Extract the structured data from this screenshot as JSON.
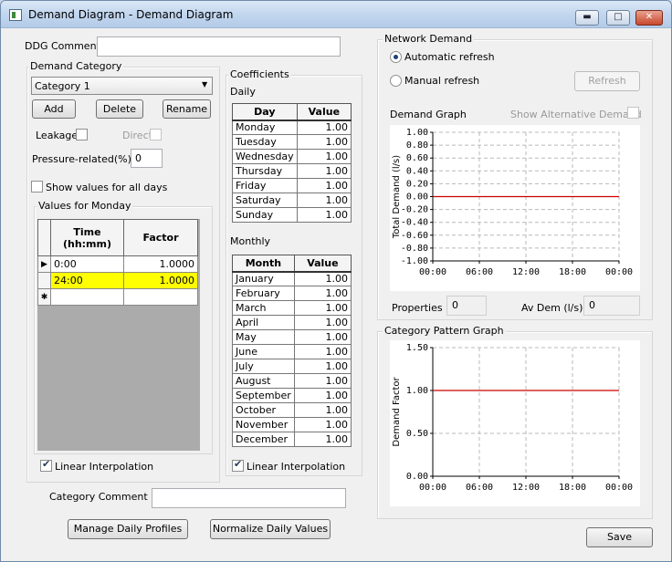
{
  "window": {
    "title": "Demand Diagram - Demand Diagram",
    "minimize": "▬",
    "maximize": "□",
    "close": "✕"
  },
  "ddg_comment": {
    "label": "DDG Comment",
    "value": ""
  },
  "demand_category": {
    "label": "Demand Category",
    "selected": "Category 1",
    "add": "Add",
    "delete": "Delete",
    "rename": "Rename",
    "leakage_label": "Leakage",
    "direct_label": "Direct",
    "pressure_label": "Pressure-related(%)",
    "pressure_value": "0",
    "show_all_days_label": "Show values for all days",
    "values_group_label": "Values for Monday",
    "table": {
      "headers": [
        "Time\n(hh:mm)",
        "Factor"
      ],
      "rows": [
        {
          "time": "0:00",
          "factor": "1.0000"
        },
        {
          "time": "24:00",
          "factor": "1.0000"
        }
      ],
      "new_row_marker": "✱",
      "current_row_marker": "▶"
    },
    "linear_interp_label": "Linear Interpolation"
  },
  "coefficients": {
    "label": "Coefficients",
    "daily_label": "Daily",
    "daily_headers": [
      "Day",
      "Value"
    ],
    "daily": [
      {
        "name": "Monday",
        "value": "1.00"
      },
      {
        "name": "Tuesday",
        "value": "1.00"
      },
      {
        "name": "Wednesday",
        "value": "1.00"
      },
      {
        "name": "Thursday",
        "value": "1.00"
      },
      {
        "name": "Friday",
        "value": "1.00"
      },
      {
        "name": "Saturday",
        "value": "1.00"
      },
      {
        "name": "Sunday",
        "value": "1.00"
      }
    ],
    "monthly_label": "Monthly",
    "monthly_headers": [
      "Month",
      "Value"
    ],
    "monthly": [
      {
        "name": "January",
        "value": "1.00"
      },
      {
        "name": "February",
        "value": "1.00"
      },
      {
        "name": "March",
        "value": "1.00"
      },
      {
        "name": "April",
        "value": "1.00"
      },
      {
        "name": "May",
        "value": "1.00"
      },
      {
        "name": "June",
        "value": "1.00"
      },
      {
        "name": "July",
        "value": "1.00"
      },
      {
        "name": "August",
        "value": "1.00"
      },
      {
        "name": "September",
        "value": "1.00"
      },
      {
        "name": "October",
        "value": "1.00"
      },
      {
        "name": "November",
        "value": "1.00"
      },
      {
        "name": "December",
        "value": "1.00"
      }
    ],
    "linear_interp_label": "Linear Interpolation"
  },
  "network_demand": {
    "label": "Network Demand",
    "auto_refresh": "Automatic refresh",
    "manual_refresh": "Manual refresh",
    "refresh_button": "Refresh",
    "graph_label": "Demand Graph",
    "show_alt_label": "Show Alternative Demand",
    "properties_label": "Properties",
    "properties_value": "0",
    "avdem_label": "Av Dem (l/s)",
    "avdem_value": "0"
  },
  "category_comment": {
    "label": "Category Comment",
    "value": ""
  },
  "buttons": {
    "manage": "Manage Daily Profiles",
    "normalize": "Normalize Daily Values",
    "save": "Save"
  },
  "pattern_group_label": "Category Pattern Graph",
  "colors": {
    "series": "#cc0000",
    "highlight": "#ffff00"
  },
  "chart_data": [
    {
      "type": "line",
      "ylabel": "Total Demand (l/s)",
      "xlabel": "",
      "x_ticks": [
        "00:00",
        "06:00",
        "12:00",
        "18:00",
        "00:00"
      ],
      "y_ticks": [
        "1.00",
        "0.80",
        "0.60",
        "0.40",
        "0.20",
        "0.00",
        "-0.20",
        "-0.40",
        "-0.60",
        "-0.80",
        "-1.00"
      ],
      "ylim": [
        -1.0,
        1.0
      ],
      "xlim": [
        0,
        24
      ],
      "grid": true,
      "series": [
        {
          "x": [
            0,
            24
          ],
          "y": [
            0.0,
            0.0
          ]
        }
      ]
    },
    {
      "type": "line",
      "ylabel": "Demand Factor",
      "xlabel": "",
      "x_ticks": [
        "00:00",
        "06:00",
        "12:00",
        "18:00",
        "00:00"
      ],
      "y_ticks": [
        "1.50",
        "1.00",
        "0.50",
        "0.00"
      ],
      "ylim": [
        0.0,
        1.5
      ],
      "xlim": [
        0,
        24
      ],
      "grid": true,
      "series": [
        {
          "x": [
            0,
            24
          ],
          "y": [
            1.0,
            1.0
          ]
        }
      ]
    }
  ]
}
